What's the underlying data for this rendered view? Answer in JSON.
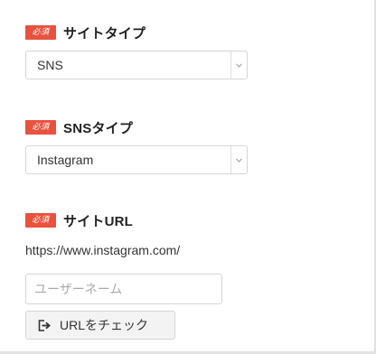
{
  "colors": {
    "badge": "#e8523f",
    "label_text": "#222222",
    "border": "#d5d5d5",
    "button_bg": "#f3f3f3",
    "placeholder": "#a9a9a9"
  },
  "site_type": {
    "required_badge": "必須",
    "label": "サイトタイプ",
    "selected_value": "SNS",
    "arrow_icon": "chevron-down-icon"
  },
  "sns_type": {
    "required_badge": "必須",
    "label": "SNSタイプ",
    "selected_value": "Instagram",
    "arrow_icon": "chevron-down-icon"
  },
  "site_url": {
    "required_badge": "必須",
    "label": "サイトURL",
    "base_url": "https://www.instagram.com/",
    "username_input": {
      "value": "",
      "placeholder": "ユーザーネーム"
    },
    "check_button": {
      "label": "URLをチェック",
      "icon": "external-link-icon"
    }
  }
}
